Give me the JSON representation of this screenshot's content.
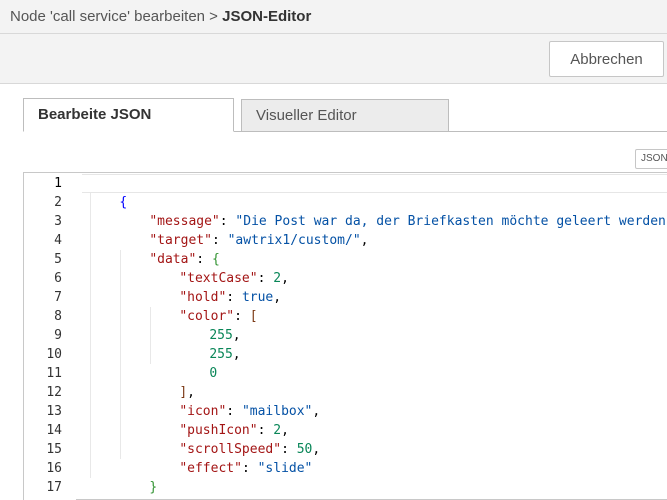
{
  "breadcrumb": {
    "parent": "Node 'call service' bearbeiten",
    "separator": " > ",
    "current": "JSON-Editor"
  },
  "toolbar": {
    "cancel_label": "Abbrechen"
  },
  "tabs": [
    {
      "label": "Bearbeite JSON",
      "active": true
    },
    {
      "label": "Visueller Editor",
      "active": false
    }
  ],
  "format_badge": "JSON",
  "editor": {
    "line_numbers": [
      "1",
      "2",
      "3",
      "4",
      "5",
      "6",
      "7",
      "8",
      "9",
      "10",
      "11",
      "12",
      "13",
      "14",
      "15",
      "16",
      "17"
    ],
    "lines": {
      "l1": {
        "open": "{"
      },
      "l2": {
        "key": "\"message\"",
        "sep": ": ",
        "val": "\"Die Post war da, der Briefkasten möchte geleert werden!\"",
        "end": ","
      },
      "l3": {
        "key": "\"target\"",
        "sep": ": ",
        "val": "\"awtrix1/custom/\"",
        "end": ","
      },
      "l4": {
        "key": "\"data\"",
        "sep": ": ",
        "open": "{"
      },
      "l5": {
        "key": "\"textCase\"",
        "sep": ": ",
        "val": "2",
        "end": ","
      },
      "l6": {
        "key": "\"hold\"",
        "sep": ": ",
        "val": "true",
        "end": ","
      },
      "l7": {
        "key": "\"color\"",
        "sep": ": ",
        "open": "["
      },
      "l8": {
        "val": "255",
        "end": ","
      },
      "l9": {
        "val": "255",
        "end": ","
      },
      "l10": {
        "val": "0"
      },
      "l11": {
        "close": "]",
        "end": ","
      },
      "l12": {
        "key": "\"icon\"",
        "sep": ": ",
        "val": "\"mailbox\"",
        "end": ","
      },
      "l13": {
        "key": "\"pushIcon\"",
        "sep": ": ",
        "val": "2",
        "end": ","
      },
      "l14": {
        "key": "\"scrollSpeed\"",
        "sep": ": ",
        "val": "50",
        "end": ","
      },
      "l15": {
        "key": "\"effect\"",
        "sep": ": ",
        "val": "\"slide\""
      },
      "l16": {
        "close": "}"
      },
      "l17": {
        "close": "}"
      }
    }
  },
  "colors": {
    "key": "#a31515",
    "string": "#0451a5",
    "number": "#098658",
    "outer_brace": "#0000ff",
    "inner_brace": "#319331",
    "bracket": "#7b3814"
  }
}
